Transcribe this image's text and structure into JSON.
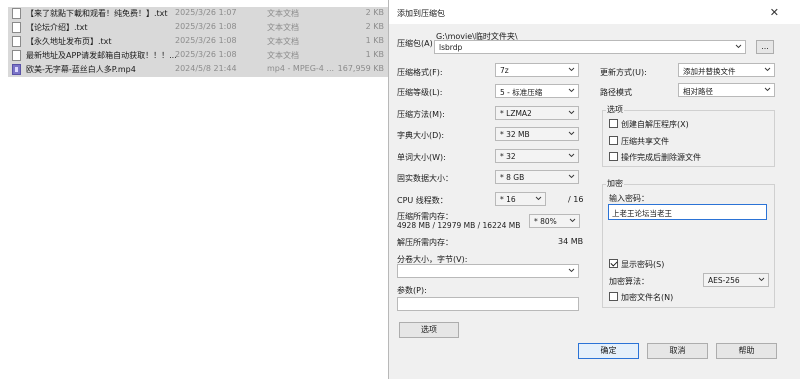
{
  "files": [
    {
      "name": "【来了就點下載和观看！纯免费！】.txt",
      "date": "2025/3/26 1:07",
      "type": "文本文档",
      "size": "2 KB",
      "icon": "text-file-icon"
    },
    {
      "name": "【论坛介绍】.txt",
      "date": "2025/3/26 1:08",
      "type": "文本文档",
      "size": "2 KB",
      "icon": "text-file-icon"
    },
    {
      "name": "【永久地址发布页】.txt",
      "date": "2025/3/26 1:08",
      "type": "文本文档",
      "size": "1 KB",
      "icon": "text-file-icon"
    },
    {
      "name": "最新地址及APP请发邮箱自动获取！！！...",
      "date": "2025/3/26 1:08",
      "type": "文本文档",
      "size": "1 KB",
      "icon": "text-file-icon"
    },
    {
      "name": "欧美-无字幕-蓝丝白人多P.mp4",
      "date": "2024/5/8 21:44",
      "type": "mp4 - MPEG-4 ...",
      "size": "167,959 KB",
      "icon": "video-file-icon"
    }
  ],
  "dialog": {
    "title": "添加到压缩包",
    "archive_label": "压缩包(A)",
    "archive_path": "G:\\movie\\临时文件夹\\",
    "archive_name": "lsbrdp",
    "browse_label": "...",
    "format_label": "压缩格式(F):",
    "format_value": "7z",
    "level_label": "压缩等级(L):",
    "level_value": "5 - 标准压缩",
    "method_label": "压缩方法(M):",
    "method_value": "* LZMA2",
    "dict_label": "字典大小(D):",
    "dict_value": "* 32 MB",
    "word_label": "单词大小(W):",
    "word_value": "* 32",
    "solid_label": "固实数据大小：",
    "solid_value": "* 8 GB",
    "cpu_label": "CPU 线程数：",
    "cpu_value": "* 16",
    "cpu_total": "/ 16",
    "mem_label": "压缩所需内存：",
    "mem_detail": "4928 MB / 12979 MB / 16224 MB",
    "mem_percent": "* 80%",
    "decomp_label": "解压所需内存：",
    "decomp_value": "34 MB",
    "split_label": "分卷大小，字节(V):",
    "split_value": "",
    "params_label": "参数(P):",
    "params_value": "",
    "options_button": "选项",
    "update_label": "更新方式(U):",
    "update_value": "添加并替换文件",
    "pathmode_label": "路径模式",
    "pathmode_value": "相对路径",
    "options_group": "选项",
    "opt_sfx": "创建自解压程序(X)",
    "opt_shared": "压缩共享文件",
    "opt_delete": "操作完成后删除源文件",
    "encrypt_group": "加密",
    "password_label": "输入密码：",
    "password_value": "上老王论坛当老王",
    "show_password": "显示密码(S)",
    "enc_method_label": "加密算法：",
    "enc_method_value": "AES-256",
    "enc_names": "加密文件名(N)",
    "ok_button": "确定",
    "cancel_button": "取消",
    "help_button": "帮助"
  }
}
